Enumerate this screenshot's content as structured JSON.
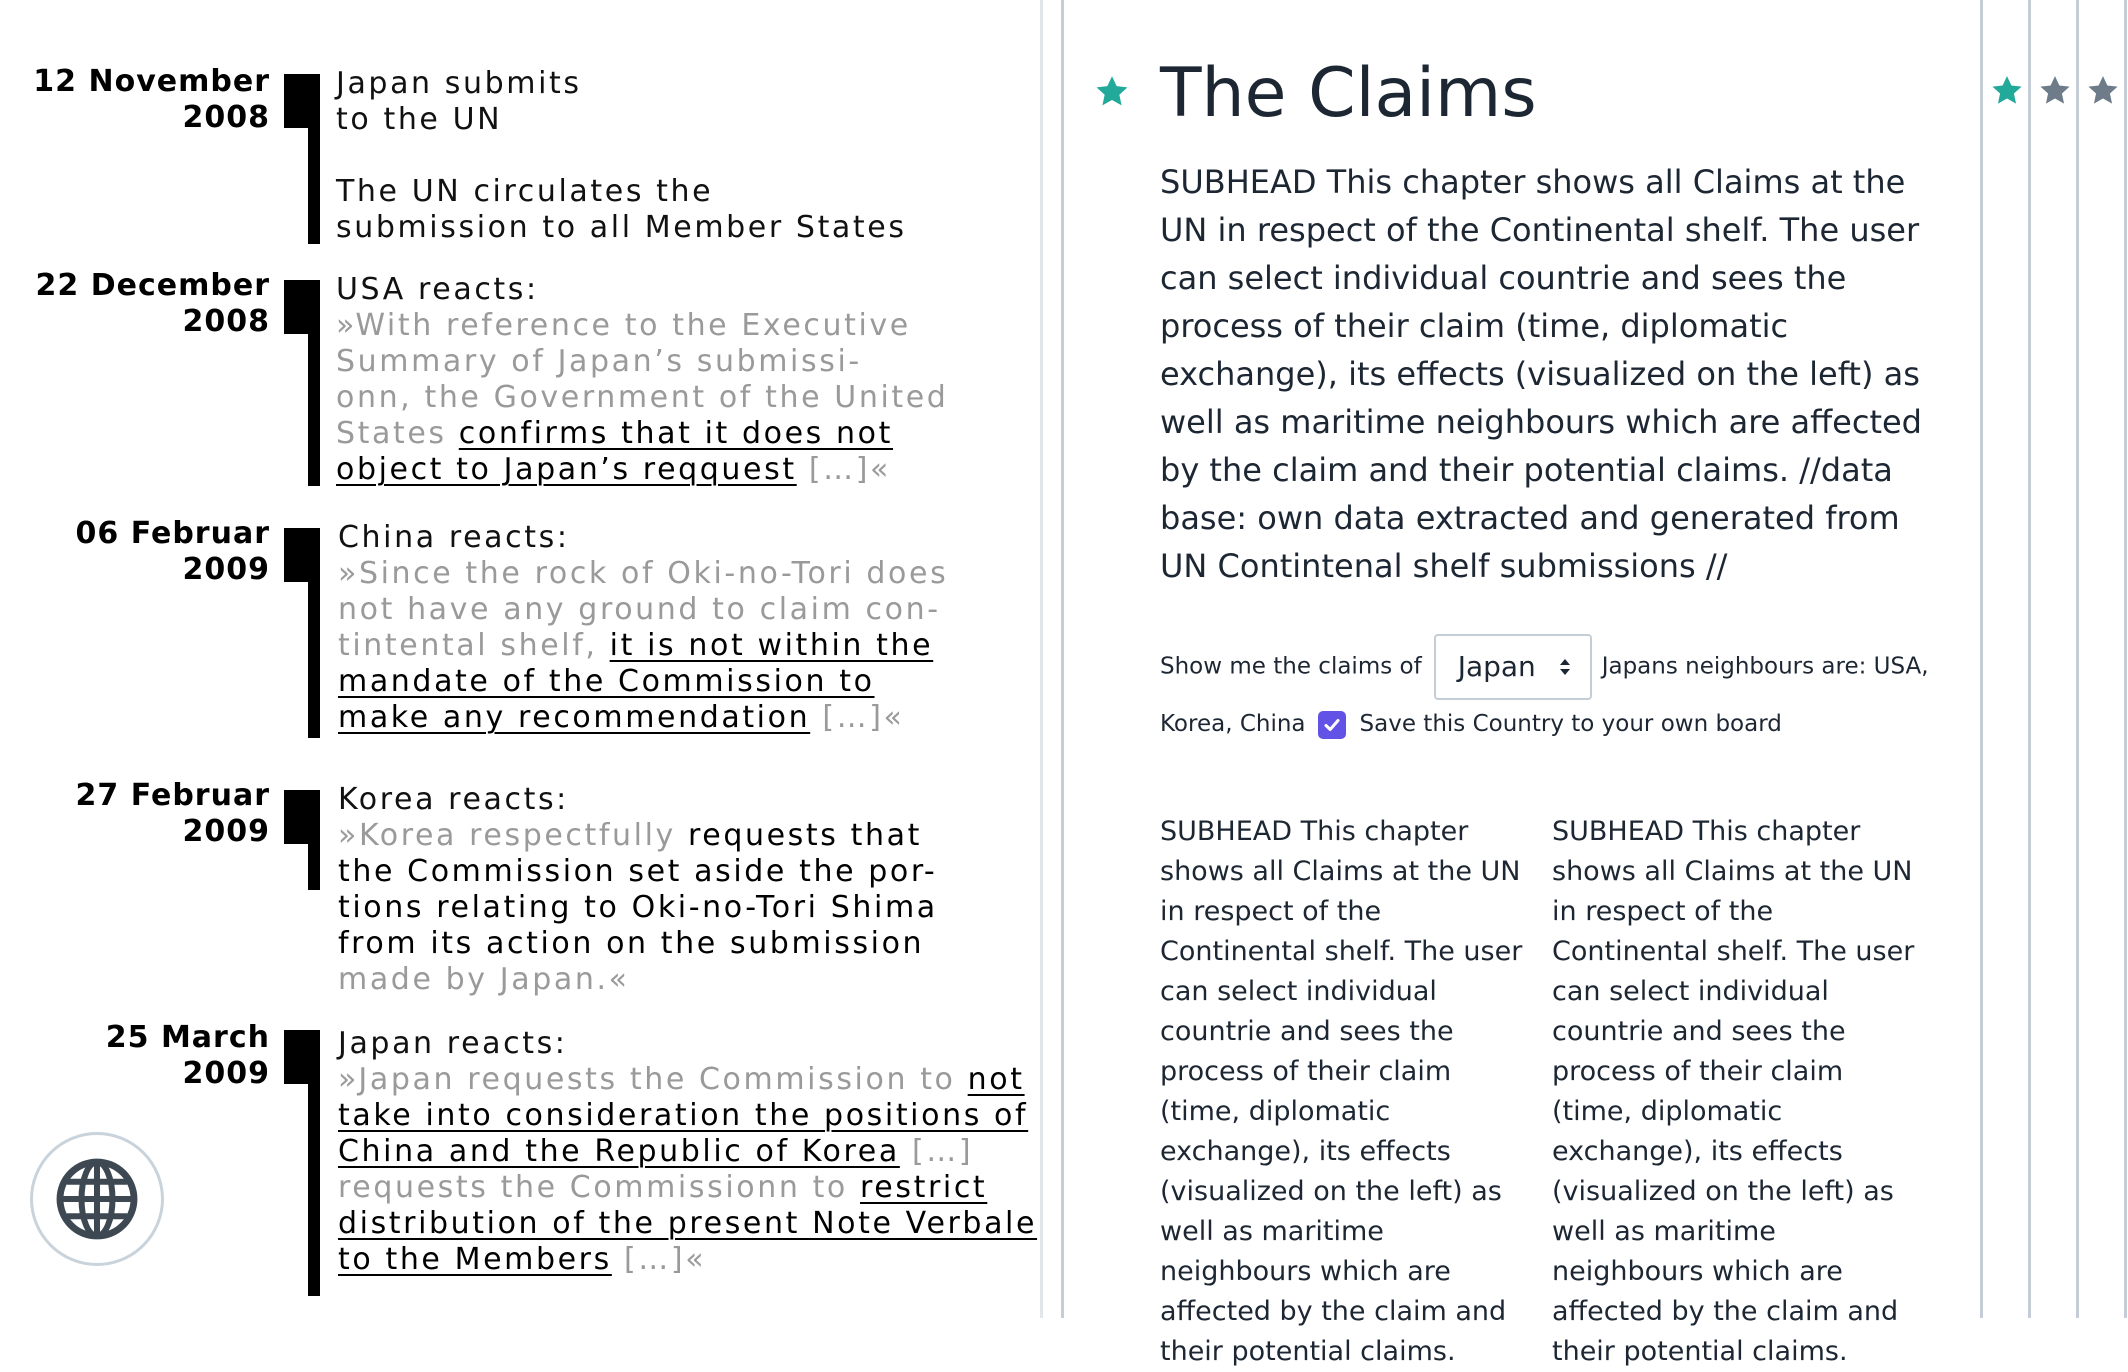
{
  "timeline": {
    "entries": [
      {
        "date_line1": "12 November",
        "date_line2": "2008",
        "lines": [
          "Japan submits",
          "to the UN"
        ],
        "lines2": [
          "The UN circulates the",
          "submission to all Member States"
        ]
      },
      {
        "date_line1": "22 December",
        "date_line2": "2008",
        "heading": "USA reacts:",
        "q1": "»With reference to the Executive",
        "q2": "Summary of Japan’s submissi-",
        "q3": "onn, the Government of the United",
        "q4": "States ",
        "u1": "confirms that it does not",
        "u2": "object to Japan’s reqquest",
        "end": " […]«"
      },
      {
        "date_line1": "06 Februar",
        "date_line2": "2009",
        "heading": "China reacts:",
        "q1": "»Since the rock of Oki-no-Tori does",
        "q2": "not have any ground to claim con-",
        "q3": "tintental shelf, ",
        "u1": "it is not within the",
        "u2": "mandate of the Commission to",
        "u3": "make any recommendation",
        "end": " […]«"
      },
      {
        "date_line1": "27 Februar",
        "date_line2": "2009",
        "heading": "Korea reacts:",
        "q1": "»Korea respectfully ",
        "k1": "requests that",
        "k2": "the Commission set aside the por-",
        "k3": "tions relating to Oki-no-Tori Shima",
        "k4": "from its action on the submission",
        "q2": "made by Japan.«"
      },
      {
        "date_line1": "25 March",
        "date_line2": "2009",
        "heading": "Japan reacts:",
        "q1": "»Japan requests the Commission to ",
        "u1": "not",
        "u2": "take into consideration the positions of",
        "u3": "China and the Republic of Korea",
        "q2": " […]",
        "q3": "requests the Commissionn to ",
        "u4": "restrict",
        "u5": "distribution of the present Note Verbale",
        "u6": "to the Members",
        "end": " […]«"
      }
    ]
  },
  "globe_button": {
    "icon": "globe-icon"
  },
  "panel": {
    "title": "The Claims",
    "lead": "SUBHEAD This chapter shows all Claims at the UN in respect of the Continental shelf. The user can select individual countrie and sees the process of their claim (time, diplomatic exchange), its effects (visualized on the left) as well as maritime neighbours which are affected by the claim and their potential claims. //data base: own data extracted and generated from UN Contintenal shelf submissions //",
    "controls": {
      "show_label": "Show me the claims of",
      "selected_country": "Japan",
      "neighbours_text": "Japans neighbours are: USA, Korea, China",
      "save_checked": true,
      "save_label": "Save this Country to your own board"
    },
    "col1": "SUBHEAD This chapter shows all Claims at the UN in respect of the Continental shelf. The user can select individual countrie and sees the process of their claim (time, diplomatic exchange), its effects (visualized on the left) as well as maritime neighbours which are affected by the claim and their potential claims.",
    "col2": "SUBHEAD This chapter shows all Claims at the UN in respect of the Continental shelf. The user can select individual countrie and sees the process of their claim (time, diplomatic exchange), its effects (visualized on the left) as well as maritime neighbours which are affected by the claim and their potential claims."
  },
  "colors": {
    "accent_star": "#22a99a",
    "inactive_star": "#6e7c89",
    "checkbox": "#6352e6",
    "text_dark": "#1d2733",
    "quote_gray": "#9a9a9a"
  }
}
